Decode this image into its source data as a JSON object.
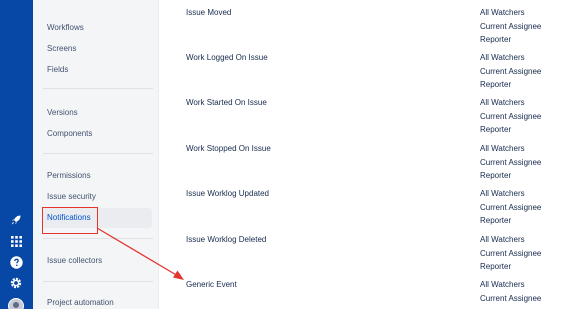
{
  "sidebar": {
    "items": [
      {
        "label": "Workflows"
      },
      {
        "label": "Screens"
      },
      {
        "label": "Fields"
      },
      {
        "label": "Versions"
      },
      {
        "label": "Components"
      },
      {
        "label": "Permissions"
      },
      {
        "label": "Issue security"
      },
      {
        "label": "Notifications"
      },
      {
        "label": "Issue collectors"
      },
      {
        "label": "Project automation"
      }
    ]
  },
  "events": [
    {
      "name": "Issue Moved",
      "recipients": [
        "All Watchers",
        "Current Assignee",
        "Reporter"
      ]
    },
    {
      "name": "Work Logged On Issue",
      "recipients": [
        "All Watchers",
        "Current Assignee",
        "Reporter"
      ]
    },
    {
      "name": "Work Started On Issue",
      "recipients": [
        "All Watchers",
        "Current Assignee",
        "Reporter"
      ]
    },
    {
      "name": "Work Stopped On Issue",
      "recipients": [
        "All Watchers",
        "Current Assignee",
        "Reporter"
      ]
    },
    {
      "name": "Issue Worklog Updated",
      "recipients": [
        "All Watchers",
        "Current Assignee",
        "Reporter"
      ]
    },
    {
      "name": "Issue Worklog Deleted",
      "recipients": [
        "All Watchers",
        "Current Assignee",
        "Reporter"
      ]
    },
    {
      "name": "Generic Event",
      "recipients": [
        "All Watchers",
        "Current Assignee"
      ]
    }
  ],
  "global_nav": {
    "icons": [
      "rocket-icon",
      "app-switcher-icon",
      "help-icon",
      "settings-icon",
      "avatar"
    ]
  },
  "colors": {
    "global_nav": "#0747a6",
    "sidebar_bg": "#f4f5f7",
    "active_link": "#0052cc",
    "annotation": "#e3342f"
  }
}
